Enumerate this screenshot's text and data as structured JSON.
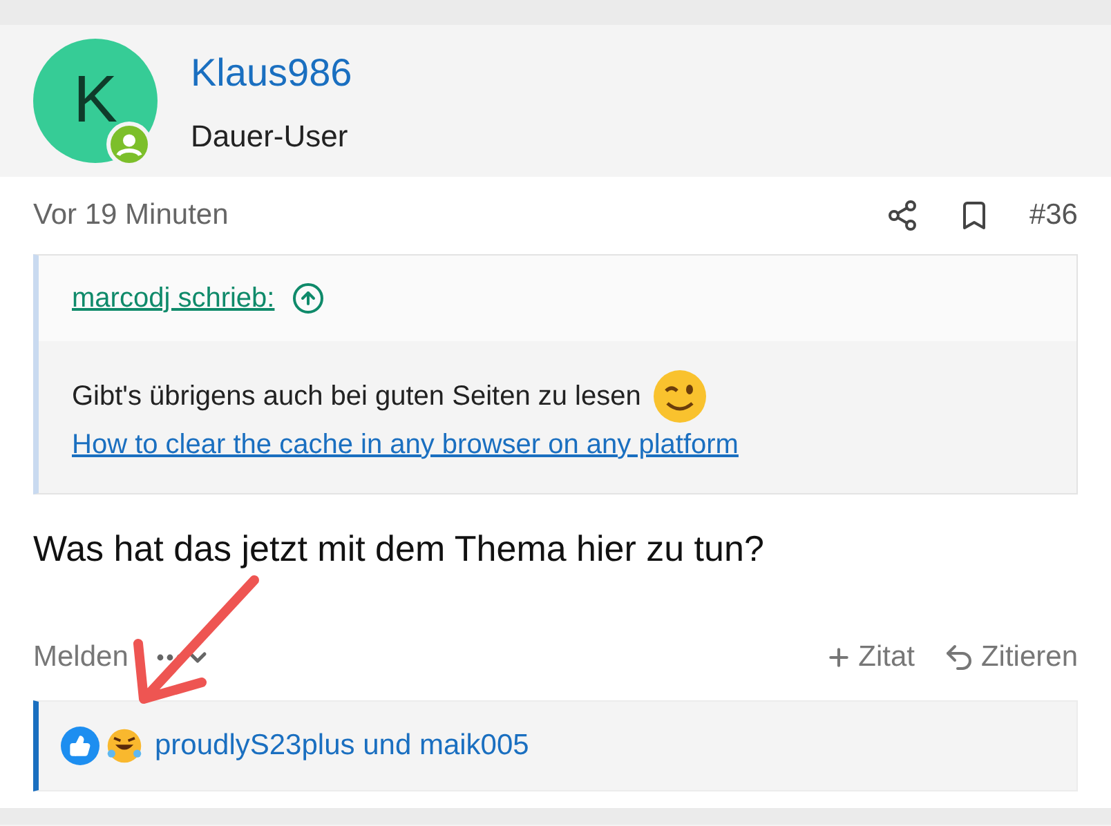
{
  "post": {
    "avatar_letter": "K",
    "author": "Klaus986",
    "role": "Dauer-User",
    "time": "Vor 19 Minuten",
    "number": "#36",
    "quote": {
      "attribution": "marcodj schrieb:",
      "text": "Gibt's übrigens auch bei guten Seiten zu lesen",
      "link": "How to clear the cache in any browser on any platform"
    },
    "body": "Was hat das jetzt mit dem Thema hier zu tun?",
    "report": "Melden",
    "actions": [
      {
        "kind": "add",
        "label": "Zitat"
      },
      {
        "kind": "reply",
        "label": "Zitieren"
      }
    ],
    "reactions": "proudlyS23plus und maik005"
  }
}
